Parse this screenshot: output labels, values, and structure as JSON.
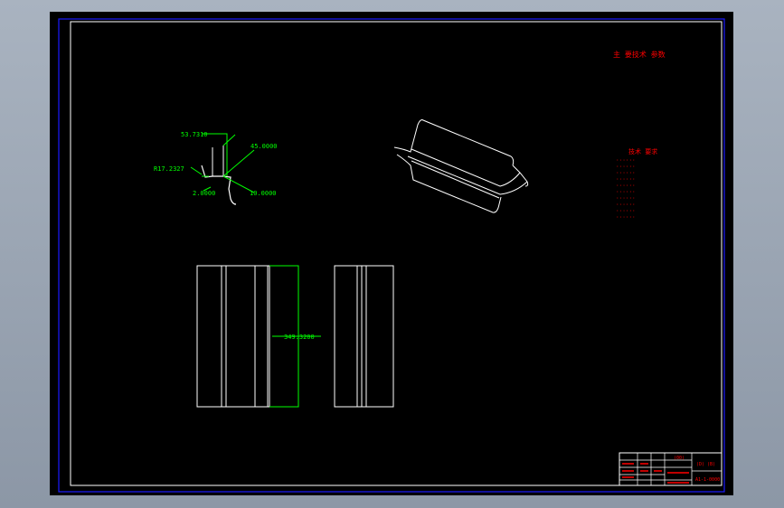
{
  "colors": {
    "background": "#000000",
    "border": "#1a1aff",
    "outline": "#ffffff",
    "dimension": "#00ff00",
    "annotation": "#ff0000"
  },
  "heading": "主 要技术 参数",
  "notes": {
    "title": "技术 要求",
    "lines": [
      "······",
      "······",
      "······",
      "······",
      "······",
      "······",
      "······",
      "······",
      "······",
      "······"
    ]
  },
  "dimensions": {
    "top_width": "53.7310",
    "radius": "R17.2327",
    "thickness": "2.0000",
    "angle_upper": "45.0000",
    "angle_lower": "10.0000",
    "length": "349.3200"
  },
  "title_block": {
    "header": "(00)",
    "side_label": "(D) (B)",
    "code": "A1-1-0000"
  }
}
